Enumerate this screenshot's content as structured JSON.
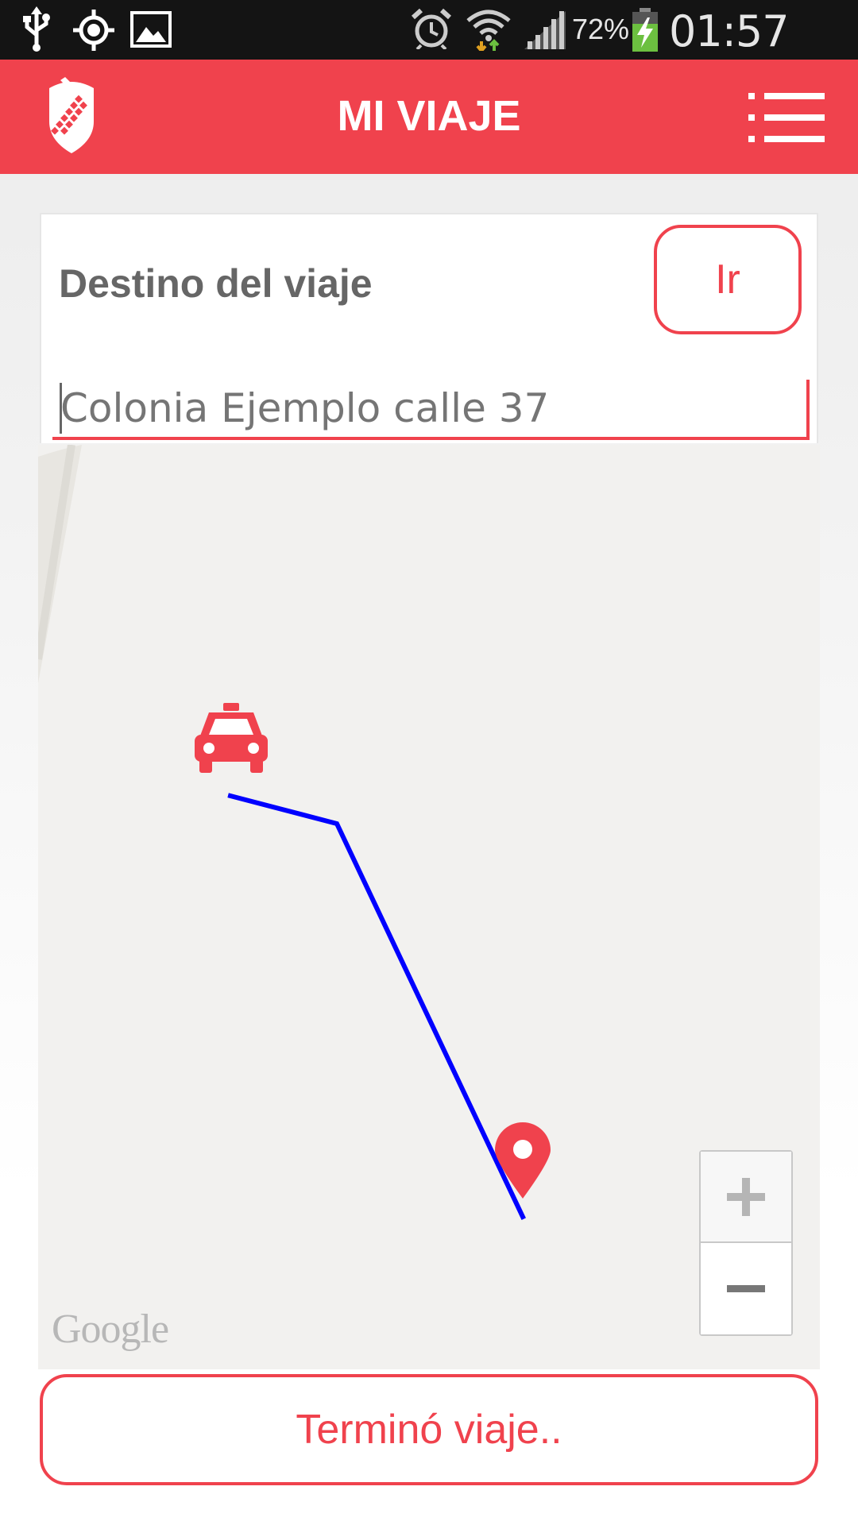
{
  "status_bar": {
    "icons": [
      "usb-icon",
      "gps-icon",
      "image-icon",
      "alarm-icon",
      "wifi-icon",
      "signal-icon",
      "battery-charging-icon"
    ],
    "battery_percent": "72%",
    "time": "01:57 PM"
  },
  "app_bar": {
    "title": "MI VIAJE",
    "logo": "shield-logo",
    "menu_icon": "menu-list-icon"
  },
  "destination": {
    "label": "Destino del viaje",
    "go_button": "Ir",
    "input_placeholder": "Colonia Ejemplo calle 37",
    "input_value": ""
  },
  "map": {
    "provider_logo": "Google",
    "markers": [
      "taxi-icon",
      "destination-pin-icon"
    ],
    "route_color": "#0000ff",
    "zoom_in_label": "+",
    "zoom_out_label": "−"
  },
  "footer": {
    "end_trip_button": "Terminó viaje.."
  },
  "colors": {
    "accent": "#f0424d",
    "status_bar": "#141414",
    "map_background": "#f2f1ef",
    "label_text": "#666666"
  }
}
